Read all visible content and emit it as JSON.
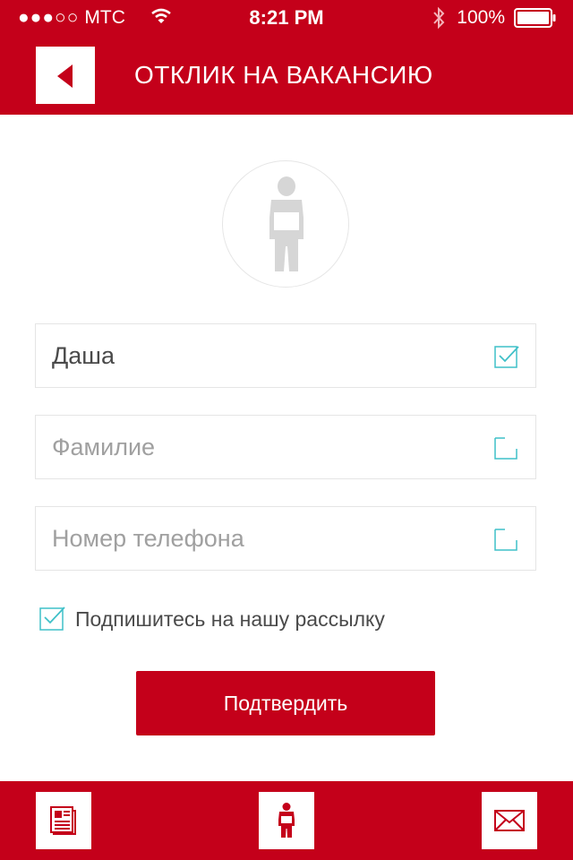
{
  "status_bar": {
    "signal": "●●●○○",
    "carrier": "МТС",
    "time": "8:21 PM",
    "battery": "100%"
  },
  "header": {
    "back_icon": "back-arrow-icon",
    "title": "ОТКЛИК НА ВАКАНСИЮ"
  },
  "avatar": {
    "icon": "person-icon"
  },
  "form": {
    "first_name": {
      "value": "Даша",
      "placeholder": "",
      "checked": true
    },
    "last_name": {
      "value": "",
      "placeholder": "Фамилие",
      "checked": false
    },
    "phone": {
      "value": "",
      "placeholder": "Номер телефона",
      "checked": false
    },
    "subscribe": {
      "label": "Подпишитесь на нашу рассылку",
      "checked": true
    },
    "submit_label": "Подтвердить"
  },
  "tab_bar": {
    "items": [
      {
        "icon": "newspaper-icon"
      },
      {
        "icon": "person-icon"
      },
      {
        "icon": "envelope-icon"
      }
    ]
  },
  "colors": {
    "brand": "#c4001a",
    "check_accent": "#3fc0c8"
  }
}
